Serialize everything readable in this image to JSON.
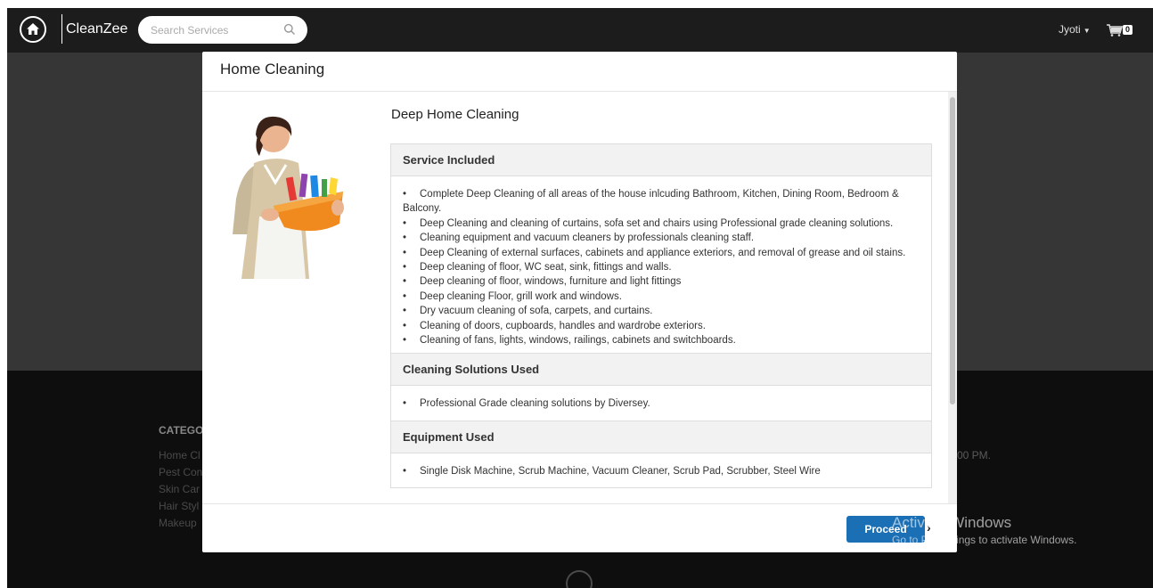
{
  "navbar": {
    "brand": "CleanZee",
    "search_placeholder": "Search Services",
    "user_name": "Jyoti",
    "cart_count": "0"
  },
  "footer": {
    "categories_title": "CATEGO",
    "categories": [
      "Home Cl",
      "Pest Con",
      "Skin Car",
      "Hair Styl",
      "Makeup"
    ],
    "hours_fragment": "00 PM."
  },
  "modal": {
    "title": "Home Cleaning",
    "service_name": "Deep Home Cleaning",
    "sections": [
      {
        "heading": "Service Included",
        "items": [
          "Complete Deep Cleaning of all areas of the house inlcuding Bathroom, Kitchen, Dining Room, Bedroom & Balcony.",
          "Deep Cleaning and cleaning of curtains, sofa set and chairs using Professional grade cleaning solutions.",
          "Cleaning equipment and vacuum cleaners by professionals cleaning staff.",
          "Deep Cleaning of external surfaces, cabinets and appliance exteriors, and removal of grease and oil stains.",
          "Deep cleaning of floor, WC seat, sink, fittings and walls.",
          "Deep cleaning of floor, windows, furniture and light fittings",
          "Deep cleaning Floor, grill work and windows.",
          "Dry vacuum cleaning of sofa, carpets, and curtains.",
          "Cleaning of doors, cupboards, handles and wardrobe exteriors.",
          "Cleaning of fans, lights, windows, railings, cabinets and switchboards."
        ]
      },
      {
        "heading": "Cleaning Solutions Used",
        "items": [
          "Professional Grade cleaning solutions by Diversey."
        ]
      },
      {
        "heading": "Equipment Used",
        "items": [
          "Single Disk Machine, Scrub Machine, Vacuum Cleaner, Scrub Pad, Scrubber, Steel Wire"
        ]
      }
    ],
    "proceed_label": "Proceed",
    "proceed_arrow": "›"
  },
  "watermark": {
    "title": "Activate Windows",
    "subtitle": "Go to PC settings to activate Windows."
  },
  "colors": {
    "navbar_bg": "#1c1c1c",
    "primary_button": "#1a6fb5",
    "footer_bg": "#0e0e0e"
  },
  "icons": [
    "home-icon",
    "search-icon",
    "cart-icon",
    "caret-down-icon",
    "chevron-right-icon"
  ]
}
